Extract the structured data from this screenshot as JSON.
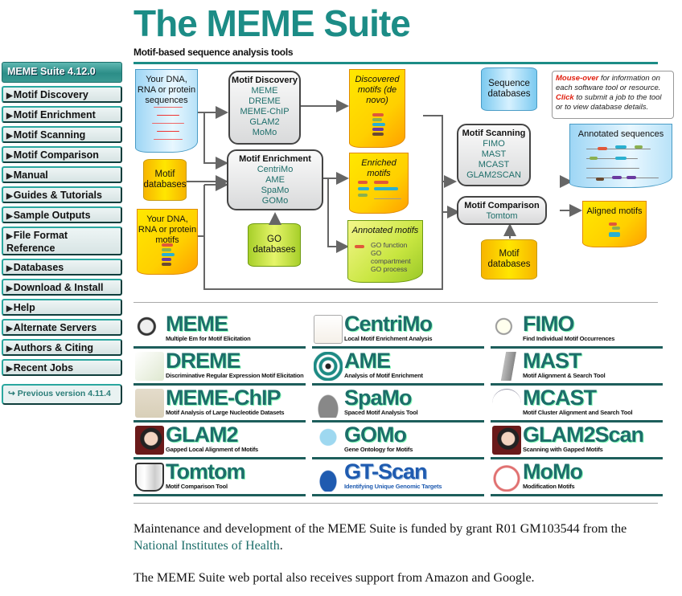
{
  "header": {
    "title": "The MEME Suite",
    "subtitle": "Motif-based sequence analysis tools"
  },
  "sidebar": {
    "title": "MEME Suite 4.12.0",
    "items": [
      {
        "label": "Motif Discovery"
      },
      {
        "label": "Motif Enrichment"
      },
      {
        "label": "Motif Scanning"
      },
      {
        "label": "Motif Comparison"
      },
      {
        "label": "Manual"
      },
      {
        "label": "Guides & Tutorials"
      },
      {
        "label": "Sample Outputs"
      },
      {
        "label": "File Format Reference"
      },
      {
        "label": "Databases"
      },
      {
        "label": "Download & Install"
      },
      {
        "label": "Help"
      },
      {
        "label": "Alternate Servers"
      },
      {
        "label": "Authors & Citing"
      },
      {
        "label": "Recent Jobs"
      }
    ],
    "previous_version": "↪ Previous version 4.11.4"
  },
  "diagram": {
    "inputs": {
      "sequences": "Your DNA, RNA or protein sequences",
      "motif_db": "Motif databases",
      "user_motifs": "Your DNA, RNA or protein motifs",
      "go_db": "GO databases",
      "seq_db": "Sequence databases",
      "motif_db2": "Motif databases"
    },
    "discovery": {
      "heading": "Motif Discovery",
      "tools": [
        "MEME",
        "DREME",
        "MEME-ChIP",
        "GLAM2",
        "MoMo"
      ]
    },
    "enrichment": {
      "heading": "Motif Enrichment",
      "tools": [
        "CentriMo",
        "AME",
        "SpaMo",
        "GOMo"
      ]
    },
    "scanning": {
      "heading": "Motif Scanning",
      "tools": [
        "FIMO",
        "MAST",
        "MCAST",
        "GLAM2SCAN"
      ]
    },
    "comparison": {
      "heading": "Motif Comparison",
      "tools": [
        "Tomtom"
      ]
    },
    "outputs": {
      "discovered": "Discovered motifs (de novo)",
      "enriched": "Enriched motifs",
      "annotated_motifs": "Annotated motifs",
      "go_terms": [
        "GO function",
        "GO compartment",
        "GO process"
      ],
      "annotated_sequences": "Annotated sequences",
      "aligned": "Aligned motifs"
    },
    "note": {
      "mouseover": "Mouse-over",
      "mouseover_rest": " for information on each software tool or resource.",
      "click": "Click",
      "click_rest": " to submit a job to the tool or to view database details."
    }
  },
  "tools": [
    {
      "name": "MEME",
      "desc": "Multiple Em for Motif Elicitation",
      "icon": "magnifier-icon"
    },
    {
      "name": "CentriMo",
      "desc": "Local Motif Enrichment Analysis",
      "icon": "peak-plot-icon"
    },
    {
      "name": "FIMO",
      "desc": "Find Individual Motif Occurrences",
      "icon": "magnifier-sequence-icon"
    },
    {
      "name": "DREME",
      "desc": "Discriminative Regular Expression Motif Elicitation",
      "icon": "sheep-logo-icon"
    },
    {
      "name": "AME",
      "desc": "Analysis of Motif Enrichment",
      "icon": "target-icon"
    },
    {
      "name": "MAST",
      "desc": "Motif Alignment & Search Tool",
      "icon": "sailboat-icon"
    },
    {
      "name": "MEME-ChIP",
      "desc": "Motif Analysis of Large Nucleotide Datasets",
      "icon": "sequence-logo-icon"
    },
    {
      "name": "SpaMo",
      "desc": "Spaced Motif Analysis Tool",
      "icon": "viking-helmet-icon"
    },
    {
      "name": "MCAST",
      "desc": "Motif Cluster Alignment and Search Tool",
      "icon": "curve-icon"
    },
    {
      "name": "GLAM2",
      "desc": "Gapped Local Alignment of Motifs",
      "icon": "woman-portrait-icon"
    },
    {
      "name": "GOMo",
      "desc": "Gene Ontology for Motifs",
      "icon": "cat-cartoon-icon"
    },
    {
      "name": "GLAM2Scan",
      "desc": "Scanning with Gapped Motifs",
      "icon": "woman-portrait-icon"
    },
    {
      "name": "Tomtom",
      "desc": "Motif Comparison Tool",
      "icon": "drum-icon"
    },
    {
      "name": "GT-Scan",
      "desc": "Identifying Unique Genomic Targets",
      "icon": "gt-scan-logo-icon"
    },
    {
      "name": "MoMo",
      "desc": "Modification Motifs",
      "icon": "apple-icon"
    }
  ],
  "footer": {
    "funding_text": "Maintenance and development of the MEME Suite is funded by grant R01 GM103544 from the ",
    "nih_link": "National Institutes of Health",
    "funding_end": ".",
    "support_text": "The MEME Suite web portal also receives support from Amazon and Google."
  },
  "colors": {
    "brand": "#1c8c86",
    "link": "#1d6e6a",
    "note_red": "#e02010"
  }
}
